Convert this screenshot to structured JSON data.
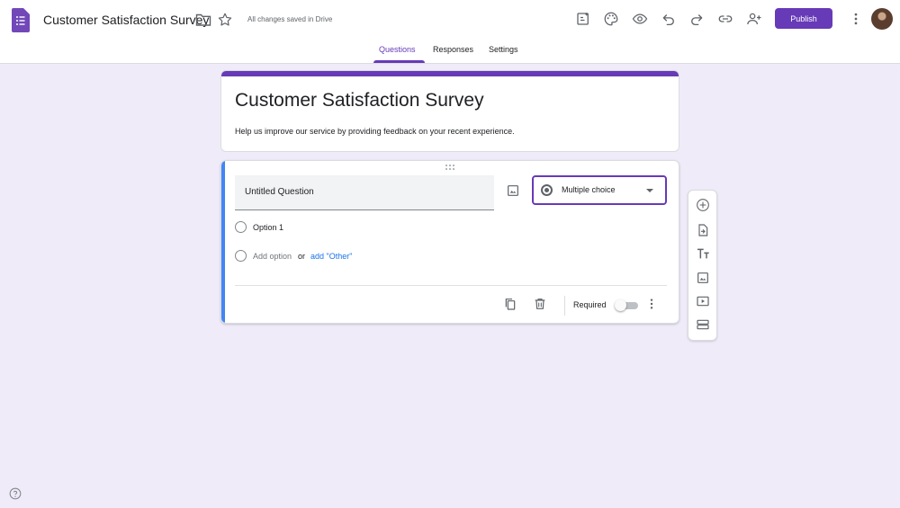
{
  "header": {
    "doc_title": "Customer Satisfaction Survey",
    "save_status": "All changes saved in Drive",
    "publish_label": "Publish",
    "icons": [
      "forms-logo-icon",
      "folder-icon",
      "star-icon",
      "addons-icon",
      "palette-icon",
      "preview-icon",
      "undo-icon",
      "redo-icon",
      "link-icon",
      "add-collaborator-icon",
      "more-vert-icon",
      "avatar"
    ]
  },
  "tabs": [
    {
      "label": "Questions",
      "active": true
    },
    {
      "label": "Responses",
      "active": false
    },
    {
      "label": "Settings",
      "active": false
    }
  ],
  "form": {
    "title": "Customer Satisfaction Survey",
    "description": "Help us improve our service by providing feedback on your recent experience."
  },
  "question": {
    "title": "Untitled Question",
    "type": "Multiple choice",
    "options": [
      "Option 1"
    ],
    "add_option": "Add option",
    "or_text": "or",
    "add_other": "add \"Other\"",
    "required_label": "Required",
    "required": false
  },
  "side_toolbar": [
    "add-question-icon",
    "import-questions-icon",
    "add-title-icon",
    "add-image-icon",
    "add-video-icon",
    "add-section-icon"
  ],
  "colors": {
    "accent": "#673ab7",
    "background": "#f0ebf8",
    "active_card_bar": "#4285f4",
    "link": "#1a73e8"
  }
}
